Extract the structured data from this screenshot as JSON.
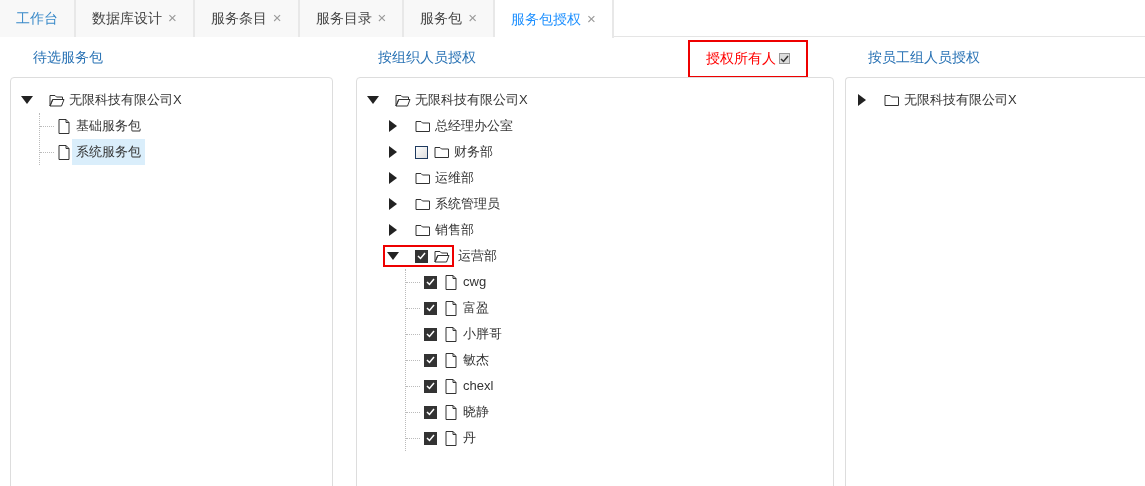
{
  "tabs": [
    {
      "label": "工作台",
      "closable": false,
      "selected": false
    },
    {
      "label": "数据库设计",
      "closable": true,
      "selected": false
    },
    {
      "label": "服务条目",
      "closable": true,
      "selected": false
    },
    {
      "label": "服务目录",
      "closable": true,
      "selected": false
    },
    {
      "label": "服务包",
      "closable": true,
      "selected": false
    },
    {
      "label": "服务包授权",
      "closable": true,
      "selected": true
    }
  ],
  "close_glyph": "×",
  "candidate_panel": {
    "title": "待选服务包",
    "tree": [
      {
        "kind": "folder",
        "label": "无限科技有限公司X",
        "expanded": true,
        "selected": false,
        "children": [
          {
            "kind": "file",
            "label": "基础服务包",
            "selected": false
          },
          {
            "kind": "file",
            "label": "系统服务包",
            "selected": true
          }
        ]
      }
    ]
  },
  "org_panel": {
    "title": "按组织人员授权",
    "authorize_all": {
      "label": "授权所有人",
      "checked": true,
      "highlighted": true
    },
    "tree": [
      {
        "kind": "folder",
        "label": "无限科技有限公司X",
        "expanded": true,
        "selected": false,
        "children": [
          {
            "kind": "folder",
            "label": "总经理办公室",
            "expanded": false,
            "selected": false
          },
          {
            "kind": "folder",
            "label": "财务部",
            "expanded": false,
            "selected": false,
            "checked": false
          },
          {
            "kind": "folder",
            "label": "运维部",
            "expanded": false,
            "selected": false
          },
          {
            "kind": "folder",
            "label": "系统管理员",
            "expanded": false,
            "selected": false
          },
          {
            "kind": "folder",
            "label": "销售部",
            "expanded": false,
            "selected": false
          },
          {
            "kind": "folder",
            "label": "运营部",
            "expanded": true,
            "selected": false,
            "checked": true,
            "highlighted": true,
            "children": [
              {
                "kind": "file",
                "label": "cwg",
                "selected": false,
                "checked": true
              },
              {
                "kind": "file",
                "label": "富盈",
                "selected": false,
                "checked": true
              },
              {
                "kind": "file",
                "label": "小胖哥",
                "selected": false,
                "checked": true
              },
              {
                "kind": "file",
                "label": "敏杰",
                "selected": false,
                "checked": true
              },
              {
                "kind": "file",
                "label": "chexl",
                "selected": false,
                "checked": true
              },
              {
                "kind": "file",
                "label": "晓静",
                "selected": false,
                "checked": true
              },
              {
                "kind": "file",
                "label": "丹",
                "selected": false,
                "checked": true
              }
            ]
          }
        ]
      }
    ]
  },
  "group_panel": {
    "title": "按员工组人员授权",
    "tree": [
      {
        "kind": "folder",
        "label": "无限科技有限公司X",
        "expanded": false,
        "selected": false
      }
    ]
  }
}
